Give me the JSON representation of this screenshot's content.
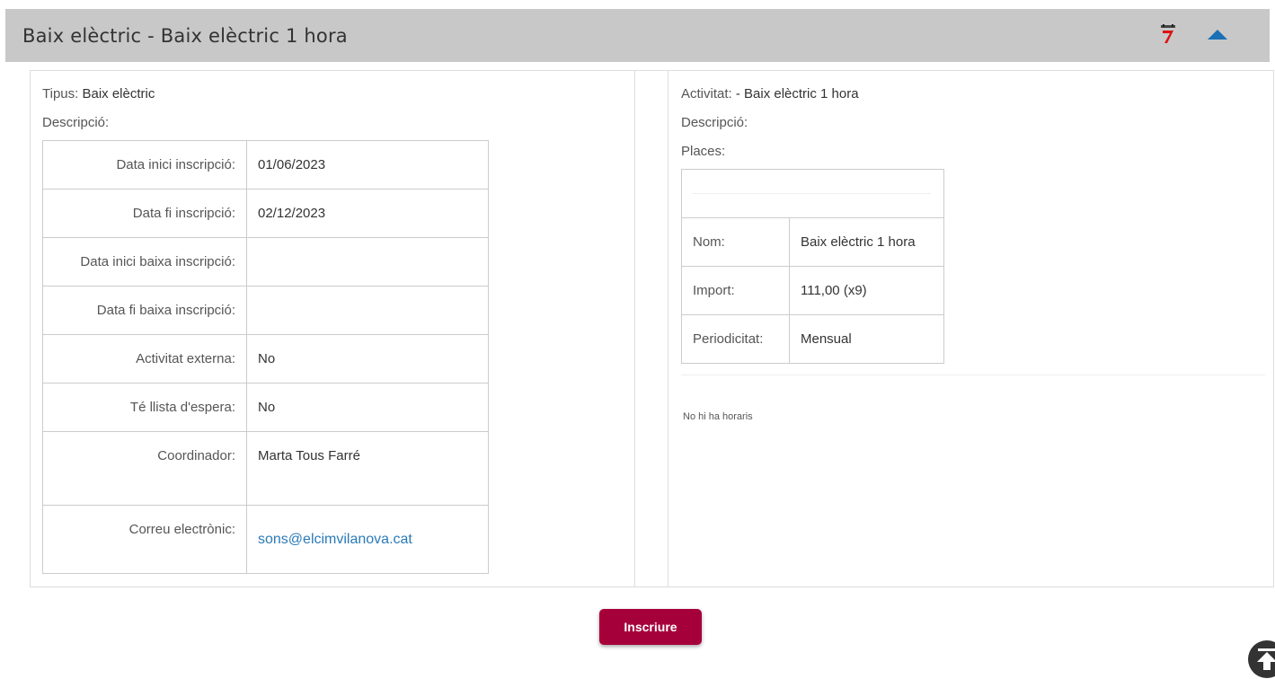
{
  "header": {
    "title": "Baix elèctric - Baix elèctric 1 hora",
    "calendar_icon": "calendar-icon",
    "collapse_icon": "chevron-up-icon"
  },
  "left": {
    "tipus_label": "Tipus:",
    "tipus_value": "Baix elèctric",
    "descripcio_label": "Descripció:",
    "table": [
      {
        "key": "Data inici inscripció:",
        "value": "01/06/2023"
      },
      {
        "key": "Data fi inscripció:",
        "value": "02/12/2023"
      },
      {
        "key": "Data inici baixa inscripció:",
        "value": ""
      },
      {
        "key": "Data fi baixa inscripció:",
        "value": ""
      },
      {
        "key": "Activitat externa:",
        "value": "No"
      },
      {
        "key": "Té llista d'espera:",
        "value": "No"
      },
      {
        "key": "Coordinador:",
        "value": "Marta Tous Farré"
      },
      {
        "key": "Correu electrònic:",
        "value": "sons@elcimvilanova.cat"
      }
    ]
  },
  "right": {
    "activitat_label": "Activitat:",
    "activitat_value": "- Baix elèctric 1 hora",
    "descripcio_label": "Descripció:",
    "places_label": "Places:",
    "places_table": [
      {
        "key": "Nom:",
        "value": "Baix elèctric 1 hora"
      },
      {
        "key": "Import:",
        "value": "111,00 (x9)"
      },
      {
        "key": "Periodicitat:",
        "value": "Mensual"
      }
    ],
    "no_horaris": "No hi ha horaris"
  },
  "actions": {
    "inscriure_label": "Inscriure"
  },
  "colors": {
    "header_bg": "#c8c8c8",
    "button_bg": "#a6003a",
    "link": "#2a7ab8",
    "chevron": "#1a6fb5"
  }
}
